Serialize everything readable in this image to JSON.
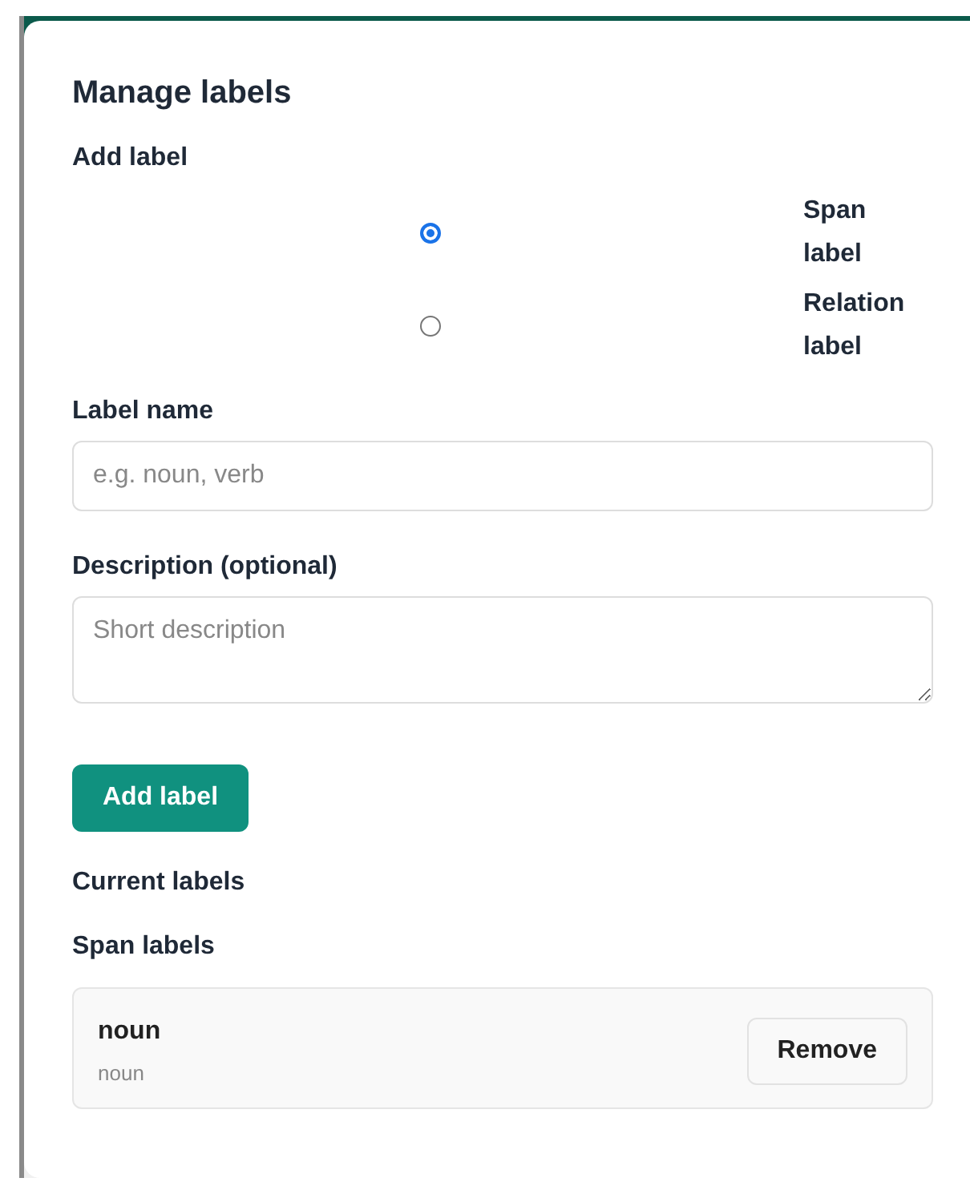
{
  "dialog": {
    "title": "Manage labels",
    "add_section": {
      "heading": "Add label",
      "label_types": [
        {
          "label": "Span label",
          "selected": true
        },
        {
          "label": "Relation label",
          "selected": false
        }
      ],
      "fields": [
        {
          "kind": "input",
          "label": "Label name",
          "placeholder": "e.g. noun, verb"
        },
        {
          "kind": "textarea",
          "label": "Description (optional)",
          "placeholder": "Short description"
        }
      ],
      "button": "Add label"
    },
    "current_section": {
      "heading": "Current labels",
      "groups": [
        {
          "heading": "Span labels",
          "items": [
            {
              "name": "noun",
              "description": "noun",
              "action": "Remove"
            }
          ]
        }
      ]
    }
  }
}
